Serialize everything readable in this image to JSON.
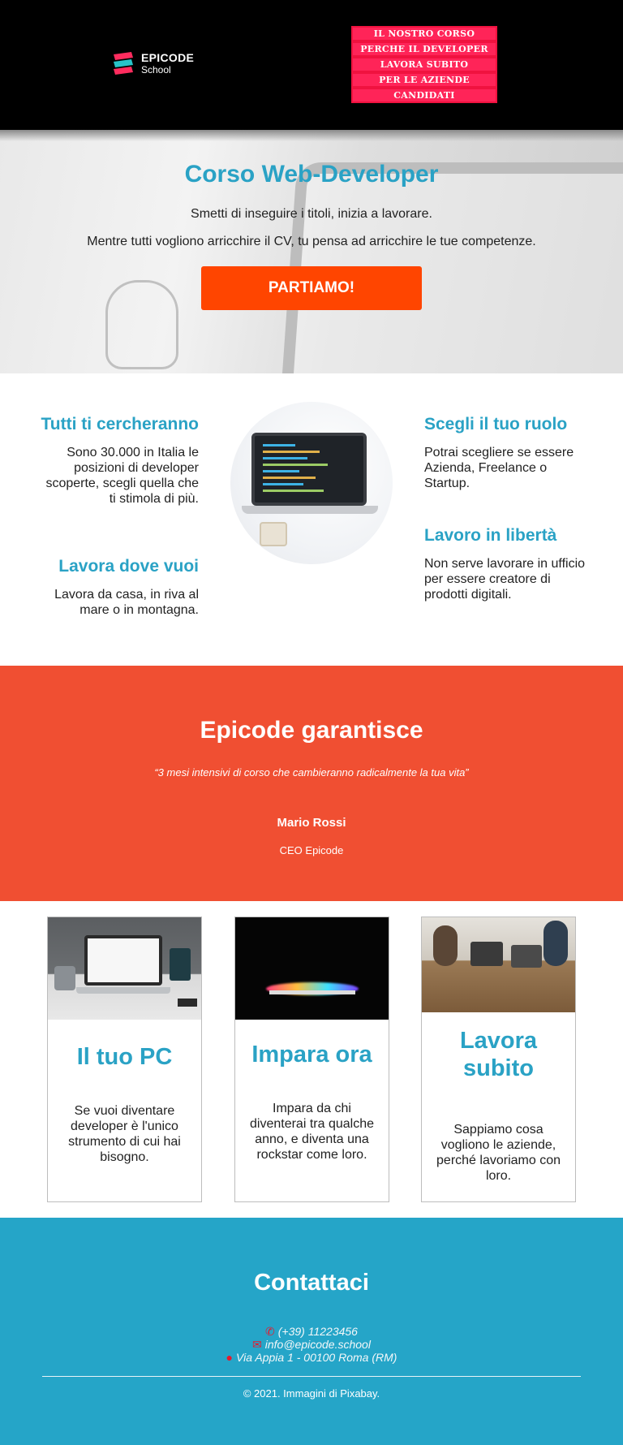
{
  "header": {
    "logo_name": "EPICODE",
    "logo_sub": "School",
    "nav": [
      {
        "label": "IL NOSTRO CORSO"
      },
      {
        "label": "PERCHE IL DEVELOPER"
      },
      {
        "label": "LAVORA SUBITO"
      },
      {
        "label": "PER LE AZIENDE"
      },
      {
        "label": "CANDIDATI"
      }
    ]
  },
  "hero": {
    "title": "Corso Web-Developer",
    "line1": "Smetti di inseguire i titoli, inizia a lavorare.",
    "line2": "Mentre tutti vogliono arricchire il CV, tu pensa ad arricchire le tue competenze.",
    "cta": "PARTIAMO!"
  },
  "features": {
    "items": [
      {
        "title": "Tutti ti cercheranno",
        "text": "Sono 30.000 in Italia le posizioni di developer scoperte, scegli quella che ti stimola di più."
      },
      {
        "title": "Lavora dove vuoi",
        "text": "Lavora da casa, in riva al mare o in montagna."
      },
      {
        "title": "Scegli il tuo ruolo",
        "text": "Potrai scegliere se essere Azienda, Freelance o Startup."
      },
      {
        "title": "Lavoro in libertà",
        "text": "Non serve lavorare in ufficio per essere creatore di prodotti digitali."
      }
    ]
  },
  "guarantee": {
    "title": "Epicode garantisce",
    "quote": "“3 mesi intensivi di corso che cambieranno radicalmente la tua vita”",
    "name": "Mario Rossi",
    "role": "CEO Epicode"
  },
  "cards": [
    {
      "title": "Il tuo PC",
      "text": "Se vuoi diventare developer è l'unico strumento di cui hai bisogno."
    },
    {
      "title": "Impara ora",
      "text": "Impara da chi diventerai tra qualche anno, e diventa una rockstar come loro."
    },
    {
      "title": "Lavora subito",
      "text": "Sappiamo cosa vogliono le aziende, perché lavoriamo con loro."
    }
  ],
  "footer": {
    "title": "Contattaci",
    "phone": "(+39) 11223456",
    "email": "info@epicode.school",
    "address": "Via Appia 1 - 00100 Roma (RM)",
    "copyright": "© 2021. Immagini di Pixabay."
  },
  "colors": {
    "accent": "#2aa2c5",
    "cta": "#ff4500",
    "guarantee_bg": "#f04f32",
    "nav_bg": "#ff2458",
    "footer_bg": "#25a5c8"
  },
  "icons": {
    "phone": "phone-icon",
    "email": "envelope-icon",
    "address": "map-marker-icon"
  }
}
